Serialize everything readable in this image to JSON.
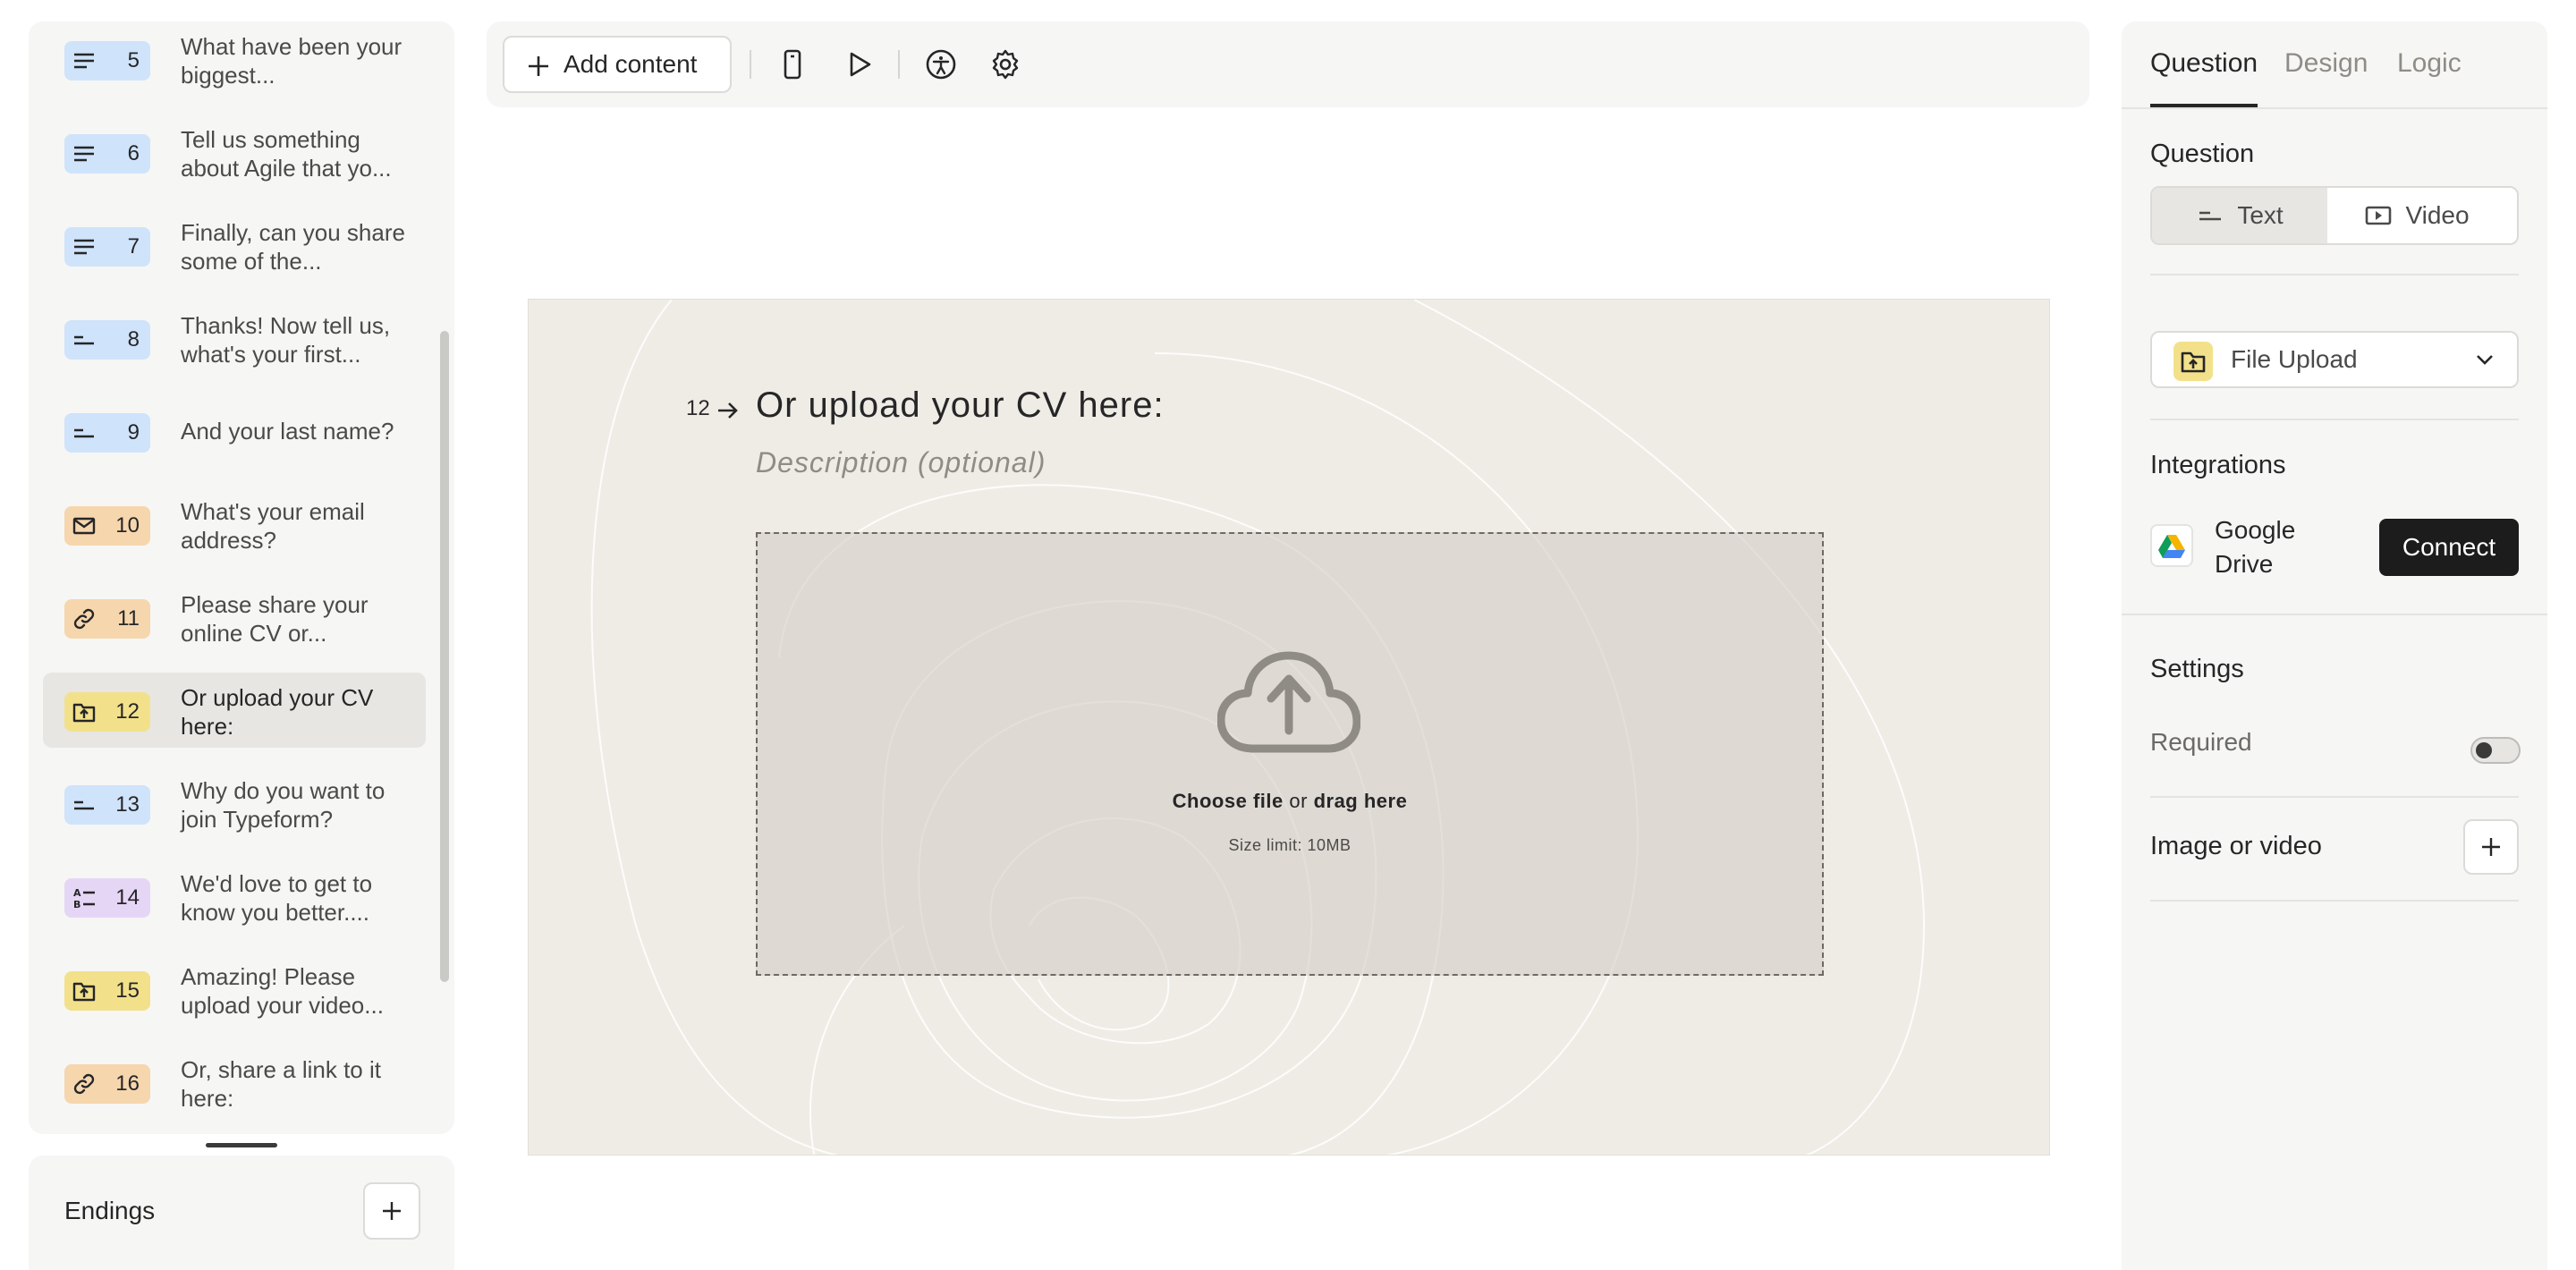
{
  "questions": [
    {
      "num": "5",
      "label": "What have been your biggest...",
      "icon": "long-text-icon",
      "color": "#cfe3fb"
    },
    {
      "num": "6",
      "label": "Tell us something about Agile that yo...",
      "icon": "long-text-icon",
      "color": "#cfe3fb"
    },
    {
      "num": "7",
      "label": "Finally, can you share some of the...",
      "icon": "long-text-icon",
      "color": "#cfe3fb"
    },
    {
      "num": "8",
      "label": "Thanks! Now tell us, what's your first...",
      "icon": "short-text-icon",
      "color": "#cfe3fb"
    },
    {
      "num": "9",
      "label": "And your last name?",
      "icon": "short-text-icon",
      "color": "#cfe3fb"
    },
    {
      "num": "10",
      "label": "What's your email address?",
      "icon": "email-icon",
      "color": "#f6d6ad"
    },
    {
      "num": "11",
      "label": "Please share your online CV or...",
      "icon": "link-icon",
      "color": "#f6d6ad"
    },
    {
      "num": "12",
      "label": "Or upload your CV here:",
      "icon": "file-upload-icon",
      "color": "#f2e18a"
    },
    {
      "num": "13",
      "label": "Why do you want to join Typeform?",
      "icon": "short-text-icon",
      "color": "#cfe3fb"
    },
    {
      "num": "14",
      "label": "We'd love to get to know you better....",
      "icon": "multiple-choice-icon",
      "color": "#e6d6f6"
    },
    {
      "num": "15",
      "label": "Amazing! Please upload your video...",
      "icon": "file-upload-icon",
      "color": "#f2e18a"
    },
    {
      "num": "16",
      "label": "Or, share a link to it here:",
      "icon": "link-icon",
      "color": "#f6d6ad"
    }
  ],
  "endings": {
    "label": "Endings"
  },
  "toolbar": {
    "add_content": "Add content"
  },
  "canvas": {
    "question_number": "12",
    "question_title": "Or upload your CV here:",
    "description_placeholder": "Description (optional)",
    "choose_file": "Choose file",
    "or_text": "or",
    "drag_here": "drag here",
    "size_limit": "Size limit: 10MB"
  },
  "panel": {
    "tabs": [
      "Question",
      "Design",
      "Logic"
    ],
    "question_heading": "Question",
    "text_option": "Text",
    "video_option": "Video",
    "type_select": "File Upload",
    "integrations_heading": "Integrations",
    "gdrive_name": "Google Drive",
    "connect_label": "Connect",
    "settings_heading": "Settings",
    "required_label": "Required",
    "required_on": false,
    "image_video_label": "Image or video"
  }
}
